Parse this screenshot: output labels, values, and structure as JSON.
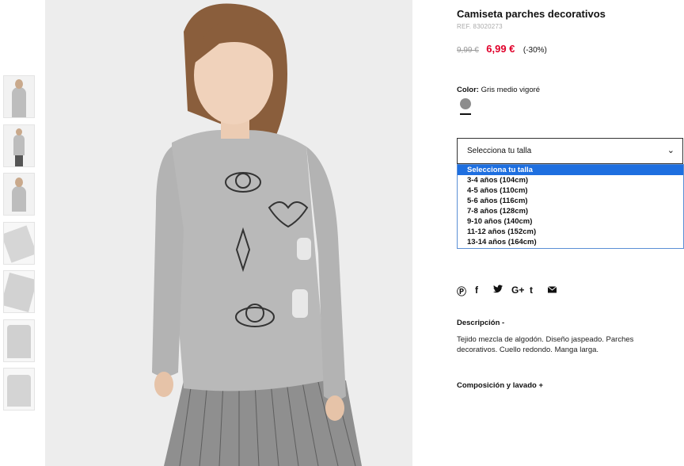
{
  "product": {
    "title": "Camiseta parches decorativos",
    "ref": "REF. 83020273",
    "old_price": "9,99 €",
    "new_price": "6,99 €",
    "discount": "(-30%)",
    "color_label": "Color:",
    "color_value": "Gris medio vigoré",
    "color_swatch": "#8d8d8d"
  },
  "size_select": {
    "value": "Selecciona tu talla",
    "options": [
      "Selecciona tu talla",
      "3-4 años (104cm)",
      "4-5 años (110cm)",
      "5-6 años (116cm)",
      "7-8 años (128cm)",
      "9-10 años (140cm)",
      "11-12 años (152cm)",
      "13-14 años (164cm)"
    ]
  },
  "share_icons": [
    "pinterest-icon",
    "facebook-icon",
    "twitter-icon",
    "google-plus-icon",
    "tumblr-icon",
    "email-icon"
  ],
  "description": {
    "heading": "Descripción -",
    "text": "Tejido mezcla de algodón. Diseño jaspeado. Parches decorativos. Cuello redondo. Manga larga."
  },
  "composition": {
    "heading": "Composición y lavado +"
  },
  "accent": "#1e6fe0",
  "price_color": "#e0002a"
}
